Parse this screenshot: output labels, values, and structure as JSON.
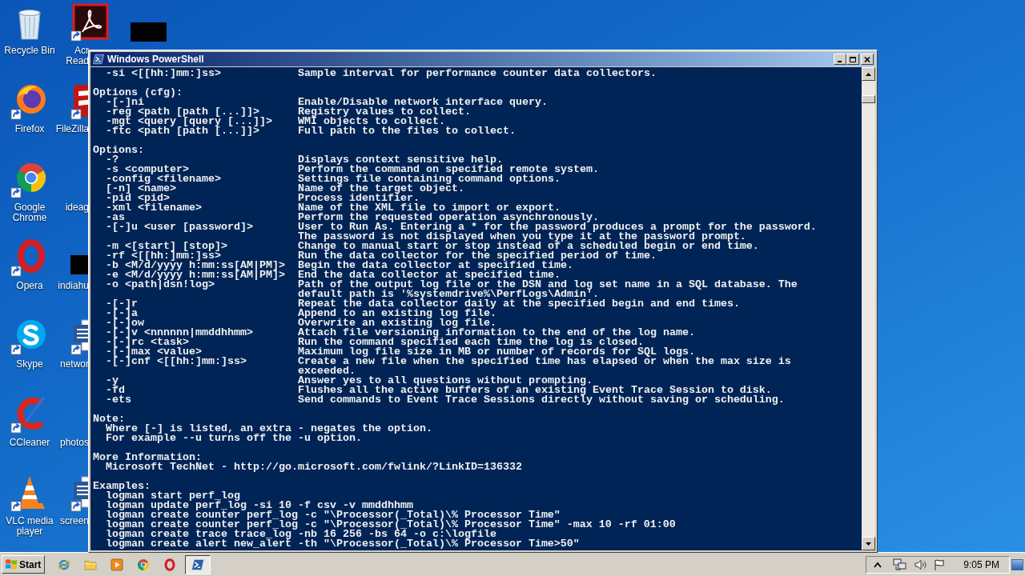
{
  "desktop": {
    "icon_columns": [
      {
        "icons": [
          {
            "kind": "recyclebin",
            "label": "Recycle Bin"
          },
          {
            "kind": "firefox",
            "label": "Firefox"
          },
          {
            "kind": "chrome",
            "label": "Google Chrome"
          },
          {
            "kind": "opera",
            "label": "Opera"
          },
          {
            "kind": "skype",
            "label": "Skype"
          },
          {
            "kind": "ccleaner",
            "label": "CCleaner"
          },
          {
            "kind": "vlc",
            "label": "VLC media player"
          }
        ]
      },
      {
        "icons": [
          {
            "kind": "acrobat",
            "label": "Acr\nRead"
          },
          {
            "kind": "filezilla",
            "label": "FileZilla"
          },
          {
            "kind": "none",
            "label": "ideag"
          },
          {
            "kind": "blackbox",
            "label": "indiahu"
          },
          {
            "kind": "worddoc",
            "label": "networ"
          },
          {
            "kind": "none",
            "label": "photos"
          },
          {
            "kind": "worddoc",
            "label": "screen"
          }
        ]
      },
      {
        "icons": [
          {
            "kind": "blackbox"
          }
        ]
      }
    ]
  },
  "window": {
    "title": "Windows PowerShell",
    "console": {
      "sections": [
        {
          "rows": [
            {
              "kind": "option",
              "option": "-si <[[hh:]mm:]ss>",
              "description": "Sample interval for performance counter data collectors."
            }
          ]
        },
        {
          "heading": "Options (cfg):",
          "rows": [
            {
              "kind": "option",
              "option": "-[-]ni",
              "description": "Enable/Disable network interface query."
            },
            {
              "kind": "option",
              "option": "-reg <path [path [...]]>",
              "description": "Registry values to collect."
            },
            {
              "kind": "option",
              "option": "-mgt <query [query [...]]>",
              "description": "WMI objects to collect."
            },
            {
              "kind": "option",
              "option": "-ftc <path [path [...]]>",
              "description": "Full path to the files to collect."
            }
          ]
        },
        {
          "heading": "Options:",
          "rows": [
            {
              "kind": "option",
              "option": "-?",
              "description": "Displays context sensitive help."
            },
            {
              "kind": "option",
              "option": "-s <computer>",
              "description": "Perform the command on specified remote system."
            },
            {
              "kind": "option",
              "option": "-config <filename>",
              "description": "Settings file containing command options."
            },
            {
              "kind": "option",
              "option": "[-n] <name>",
              "description": "Name of the target object."
            },
            {
              "kind": "option",
              "option": "-pid <pid>",
              "description": "Process identifier."
            },
            {
              "kind": "option",
              "option": "-xml <filename>",
              "description": "Name of the XML file to import or export."
            },
            {
              "kind": "option",
              "option": "-as",
              "description": "Perform the requested operation asynchronously."
            },
            {
              "kind": "option",
              "option": "-[-]u <user [password]>",
              "description": "User to Run As. Entering a * for the password produces a prompt for the password."
            },
            {
              "kind": "continuation",
              "description": "The password is not displayed when you type it at the password prompt."
            },
            {
              "kind": "option",
              "option": "-m <[start] [stop]>",
              "description": "Change to manual start or stop instead of a scheduled begin or end time."
            },
            {
              "kind": "option",
              "option": "-rf <[[hh:]mm:]ss>",
              "description": "Run the data collector for the specified period of time."
            },
            {
              "kind": "option",
              "option": "-b <M/d/yyyy h:mm:ss[AM|PM]>",
              "description": "Begin the data collector at specified time."
            },
            {
              "kind": "option",
              "option": "-e <M/d/yyyy h:mm:ss[AM|PM]>",
              "description": "End the data collector at specified time."
            },
            {
              "kind": "option",
              "option": "-o <path|dsn!log>",
              "description": "Path of the output log file or the DSN and log set name in a SQL database. The"
            },
            {
              "kind": "continuation",
              "description": "default path is '%systemdrive%\\PerfLogs\\Admin'."
            },
            {
              "kind": "option",
              "option": "-[-]r",
              "description": "Repeat the data collector daily at the specified begin and end times."
            },
            {
              "kind": "option",
              "option": "-[-]a",
              "description": "Append to an existing log file."
            },
            {
              "kind": "option",
              "option": "-[-]ow",
              "description": "Overwrite an existing log file."
            },
            {
              "kind": "option",
              "option": "-[-]v <nnnnnn|mmddhhmm>",
              "description": "Attach file versioning information to the end of the log name."
            },
            {
              "kind": "option",
              "option": "-[-]rc <task>",
              "description": "Run the command specified each time the log is closed."
            },
            {
              "kind": "option",
              "option": "-[-]max <value>",
              "description": "Maximum log file size in MB or number of records for SQL logs."
            },
            {
              "kind": "option",
              "option": "-[-]cnf <[[hh:]mm:]ss>",
              "description": "Create a new file when the specified time has elapsed or when the max size is"
            },
            {
              "kind": "continuation",
              "description": "exceeded."
            },
            {
              "kind": "option",
              "option": "-y",
              "description": "Answer yes to all questions without prompting."
            },
            {
              "kind": "option",
              "option": "-fd",
              "description": "Flushes all the active buffers of an existing Event Trace Session to disk."
            },
            {
              "kind": "option",
              "option": "-ets",
              "description": "Send commands to Event Trace Sessions directly without saving or scheduling."
            }
          ]
        },
        {
          "heading": "Note:",
          "rows": [
            {
              "kind": "text",
              "text": "Where [-] is listed, an extra - negates the option."
            },
            {
              "kind": "text",
              "text": "For example --u turns off the -u option."
            }
          ]
        },
        {
          "heading": "More Information:",
          "rows": [
            {
              "kind": "text",
              "text": "Microsoft TechNet - http://go.microsoft.com/fwlink/?LinkID=136332"
            }
          ]
        },
        {
          "heading": "Examples:",
          "rows": [
            {
              "kind": "text",
              "text": "logman start perf_log"
            },
            {
              "kind": "text",
              "text": "logman update perf_log -si 10 -f csv -v mmddhhmm"
            },
            {
              "kind": "text",
              "text": "logman create counter perf_log -c \"\\Processor(_Total)\\% Processor Time\""
            },
            {
              "kind": "text",
              "text": "logman create counter perf_log -c \"\\Processor(_Total)\\% Processor Time\" -max 10 -rf 01:00"
            },
            {
              "kind": "text",
              "text": "logman create trace trace_log -nb 16 256 -bs 64 -o c:\\logfile"
            },
            {
              "kind": "text",
              "text": "logman create alert new_alert -th \"\\Processor(_Total)\\% Processor Time>50\""
            }
          ]
        }
      ]
    }
  },
  "taskbar": {
    "start_label": "Start",
    "task_buttons": [
      {
        "selected": true
      }
    ],
    "clock": "9:05 PM"
  }
}
